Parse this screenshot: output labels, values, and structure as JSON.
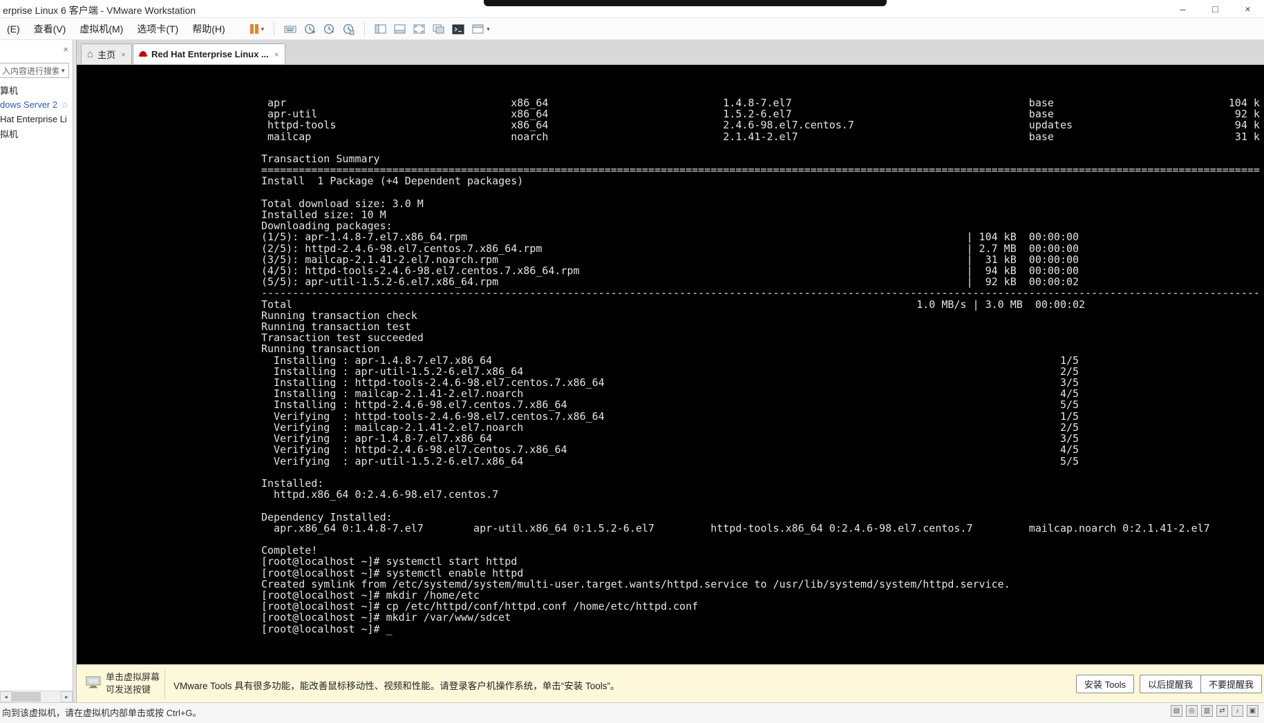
{
  "window": {
    "title": "erprise Linux 6 客户端 - VMware Workstation",
    "controls": {
      "minimize": "–",
      "maximize": "□",
      "close": "×"
    }
  },
  "menubar": {
    "items": [
      "(E)",
      "查看(V)",
      "虚拟机(M)",
      "选项卡(T)",
      "帮助(H)"
    ]
  },
  "toolbar": {
    "icon_names": [
      "suspend-vm",
      "send-ctrl-alt-del",
      "take-snapshot",
      "revert-snapshot",
      "snapshot-manager",
      "show-library",
      "show-thumbnail-bar",
      "fullscreen",
      "unity-mode",
      "console-view",
      "console-view-options"
    ]
  },
  "tabs": [
    {
      "label": "主页"
    },
    {
      "label": "Red Hat Enterprise Linux ..."
    }
  ],
  "sidebar": {
    "search_placeholder": "入内容进行搜索",
    "items": [
      {
        "label": "算机"
      },
      {
        "label": "dows Server 2",
        "starred": true
      },
      {
        "label": "Hat Enterprise Li"
      },
      {
        "label": "拟机"
      }
    ]
  },
  "icons": {
    "close": "×",
    "home": "⌂",
    "star": "☆",
    "caret_down": "▾",
    "search_caret": "▼",
    "scroll_left": "◂",
    "scroll_right": "▸"
  },
  "terminal": {
    "lines": [
      " apr                                    x86_64                            1.4.8-7.el7                                      base                            104 k",
      " apr-util                               x86_64                            1.5.2-6.el7                                      base                             92 k",
      " httpd-tools                            x86_64                            2.4.6-98.el7.centos.7                            updates                          94 k",
      " mailcap                                noarch                            2.1.41-2.el7                                     base                             31 k",
      "",
      "Transaction Summary",
      "================================================================================================================================================================",
      "Install  1 Package (+4 Dependent packages)",
      "",
      "Total download size: 3.0 M",
      "Installed size: 10 M",
      "Downloading packages:",
      "(1/5): apr-1.4.8-7.el7.x86_64.rpm                                                                                | 104 kB  00:00:00",
      "(2/5): httpd-2.4.6-98.el7.centos.7.x86_64.rpm                                                                    | 2.7 MB  00:00:00",
      "(3/5): mailcap-2.1.41-2.el7.noarch.rpm                                                                           |  31 kB  00:00:00",
      "(4/5): httpd-tools-2.4.6-98.el7.centos.7.x86_64.rpm                                                              |  94 kB  00:00:00",
      "(5/5): apr-util-1.5.2-6.el7.x86_64.rpm                                                                           |  92 kB  00:00:02",
      "----------------------------------------------------------------------------------------------------------------------------------------------------------------",
      "Total                                                                                                    1.0 MB/s | 3.0 MB  00:00:02",
      "Running transaction check",
      "Running transaction test",
      "Transaction test succeeded",
      "Running transaction",
      "  Installing : apr-1.4.8-7.el7.x86_64                                                                                           1/5",
      "  Installing : apr-util-1.5.2-6.el7.x86_64                                                                                      2/5",
      "  Installing : httpd-tools-2.4.6-98.el7.centos.7.x86_64                                                                         3/5",
      "  Installing : mailcap-2.1.41-2.el7.noarch                                                                                      4/5",
      "  Installing : httpd-2.4.6-98.el7.centos.7.x86_64                                                                               5/5",
      "  Verifying  : httpd-tools-2.4.6-98.el7.centos.7.x86_64                                                                         1/5",
      "  Verifying  : mailcap-2.1.41-2.el7.noarch                                                                                      2/5",
      "  Verifying  : apr-1.4.8-7.el7.x86_64                                                                                           3/5",
      "  Verifying  : httpd-2.4.6-98.el7.centos.7.x86_64                                                                               4/5",
      "  Verifying  : apr-util-1.5.2-6.el7.x86_64                                                                                      5/5",
      "",
      "Installed:",
      "  httpd.x86_64 0:2.4.6-98.el7.centos.7",
      "",
      "Dependency Installed:",
      "  apr.x86_64 0:1.4.8-7.el7        apr-util.x86_64 0:1.5.2-6.el7         httpd-tools.x86_64 0:2.4.6-98.el7.centos.7         mailcap.noarch 0:2.1.41-2.el7",
      "",
      "Complete!",
      "[root@localhost ~]# systemctl start httpd",
      "[root@localhost ~]# systemctl enable httpd",
      "Created symlink from /etc/systemd/system/multi-user.target.wants/httpd.service to /usr/lib/systemd/system/httpd.service.",
      "[root@localhost ~]# mkdir /home/etc",
      "[root@localhost ~]# cp /etc/httpd/conf/httpd.conf /home/etc/httpd.conf",
      "[root@localhost ~]# mkdir /var/www/sdcet",
      "[root@localhost ~]# _"
    ]
  },
  "hintbar": {
    "hint_line1": "单击虚拟屏幕",
    "hint_line2": "可发送按键",
    "message": "VMware Tools 具有很多功能，能改善鼠标移动性、视频和性能。请登录客户机操作系统，单击“安装 Tools”。",
    "buttons": [
      "安装 Tools",
      "以后提醒我",
      "不要提醒我"
    ]
  },
  "statusbar": {
    "message": "向到该虚拟机，请在虚拟机内部单击或按 Ctrl+G。",
    "device_icons": [
      {
        "name": "hard-disk",
        "glyph": "▤"
      },
      {
        "name": "cd-rom",
        "glyph": "◎"
      },
      {
        "name": "floppy",
        "glyph": "▥"
      },
      {
        "name": "network-adapter",
        "glyph": "⇄"
      },
      {
        "name": "sound",
        "glyph": "♪"
      },
      {
        "name": "usb",
        "glyph": "▣"
      }
    ]
  },
  "colors": {
    "terminal_bg": "#000000",
    "terminal_fg": "#e4e4e4",
    "hintbar_bg": "#fdf8da",
    "suspend_orange": "#e2842e",
    "tab_active_bg": "#ffffff",
    "redhat_red": "#c70000"
  }
}
